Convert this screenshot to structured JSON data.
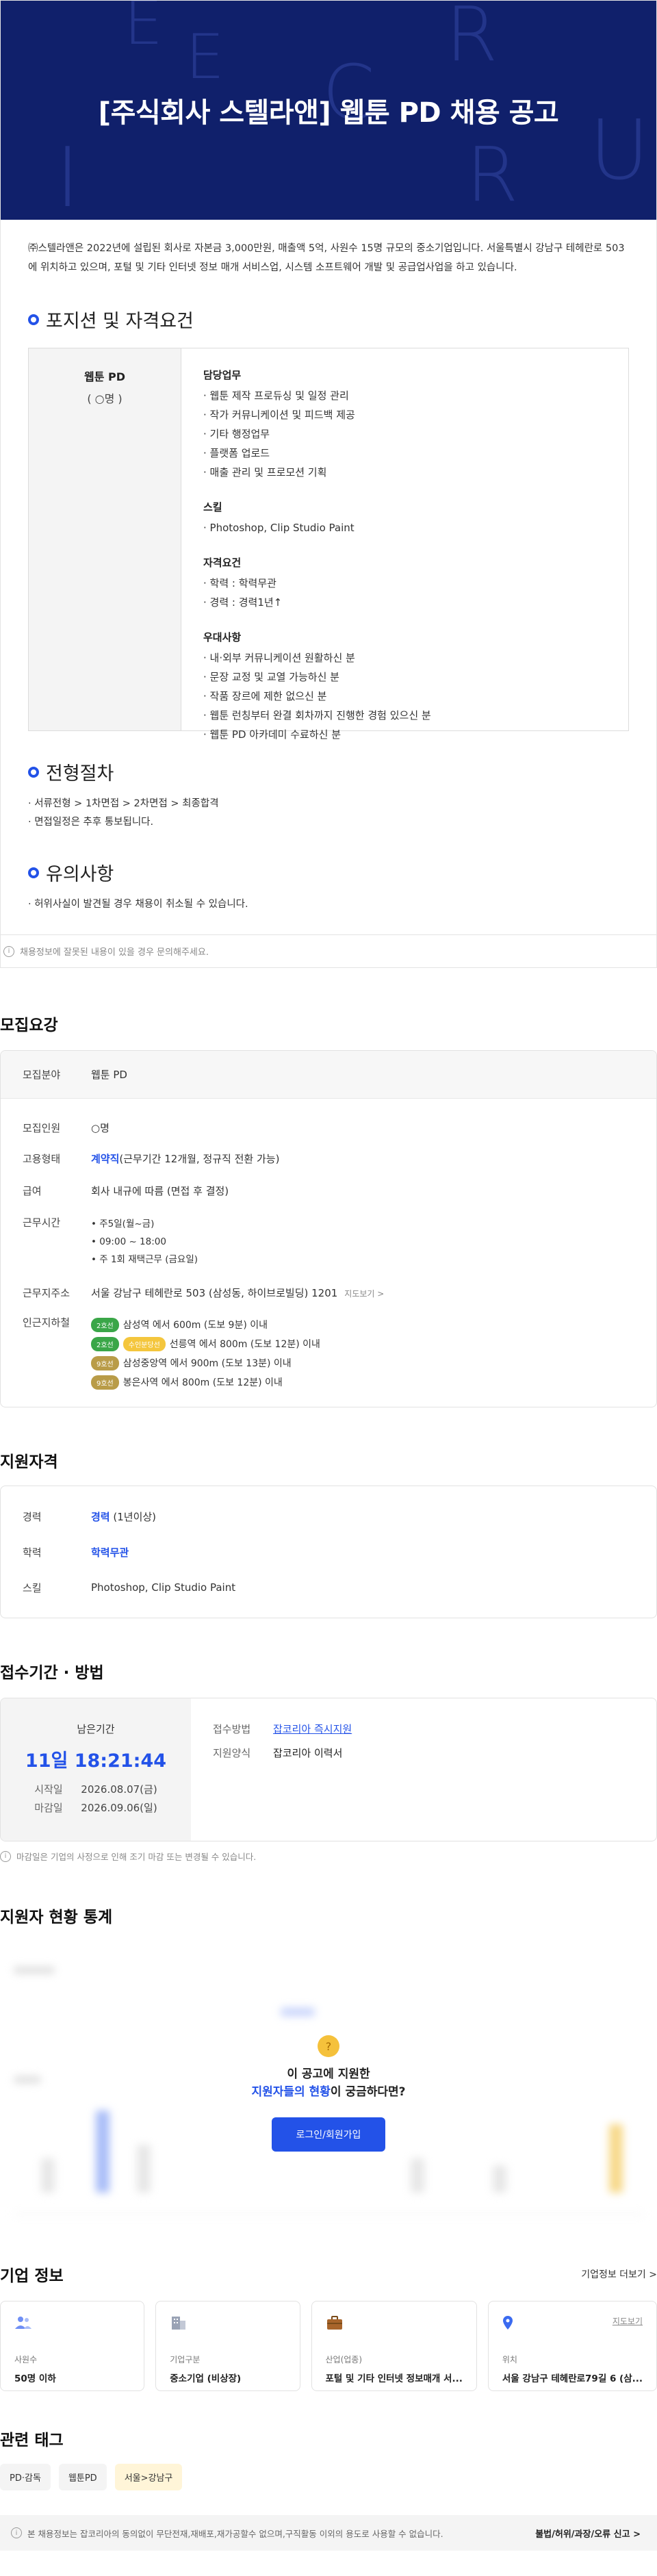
{
  "detail": {
    "hero_title": "[주식회사 스텔라앤] 웹툰 PD 채용 공고",
    "hero_letters": [
      "E",
      "E",
      "R",
      "C",
      "U",
      "I",
      "R"
    ],
    "intro": "㈜스텔라앤은 2022년에 설립된 회사로 자본금 3,000만원, 매출액 5억, 사원수 15명 규모의 중소기업입니다. 서울특별시 강남구 테헤란로 503에 위치하고 있으며, 포털 및 기타 인터넷 정보 매개 서비스업, 시스템 소프트웨어 개발 및 공급업사업을 하고 있습니다.",
    "position_heading": "포지션 및 자격요건",
    "position": {
      "title": "웹툰 PD",
      "count": "( ○명 )",
      "groups": [
        {
          "heading": "담당업무",
          "items": [
            "· 웹툰 제작 프로듀싱 및 일정 관리",
            "· 작가 커뮤니케이션 및 피드백 제공",
            "· 기타 행정업무",
            "· 플랫폼 업로드",
            "· 매출 관리 및 프로모션 기획"
          ]
        },
        {
          "heading": "스킬",
          "items": [
            "· Photoshop, Clip Studio Paint"
          ]
        },
        {
          "heading": "자격요건",
          "items": [
            "· 학력 : 학력무관",
            "· 경력 : 경력1년↑"
          ]
        },
        {
          "heading": "우대사항",
          "items": [
            "· 내·외부 커뮤니케이션 원활하신 분",
            "· 문장 교정 및 교열 가능하신 분",
            "· 작품 장르에 제한 없으신 분",
            "· 웹툰 런칭부터 완결 회차까지 진행한 경험 있으신 분",
            "· 웹툰 PD 아카데미 수료하신 분"
          ]
        }
      ]
    },
    "process_heading": "전형절차",
    "process": [
      "· 서류전형 > 1차면접 > 2차면접 > 최종합격",
      "· 면접일정은 추후 통보됩니다."
    ],
    "caution_heading": "유의사항",
    "caution": [
      "· 허위사실이 발견될 경우 채용이 취소될 수 있습니다."
    ],
    "notice": "채용정보에 잘못된 내용이 있을 경우 문의해주세요."
  },
  "recruit": {
    "title": "모집요강",
    "field_label": "모집분야",
    "field_value": "웹툰 PD",
    "rows": [
      {
        "k": "모집인원",
        "v": "○명"
      }
    ],
    "employment_label": "고용형태",
    "employment_strong": "계약직",
    "employment_rest": "(근무기간 12개월, 정규직 전환 가능)",
    "salary_label": "급여",
    "salary_value": "회사 내규에 따름 (면접 후 결정)",
    "worktime_label": "근무시간",
    "worktime": [
      "• 주5일(월~금)",
      "• 09:00 ~ 18:00",
      "• 주 1회 재택근무 (금요일)"
    ],
    "address_label": "근무지주소",
    "address_value": "서울 강남구 테헤란로 503 (삼성동, 하이브로빌딩) 1201",
    "map_link": "지도보기 >",
    "subway_label": "인근지하철",
    "subway": [
      {
        "badges": [
          {
            "text": "2호선",
            "cls": "b2"
          }
        ],
        "text": "삼성역 에서 600m (도보 9분) 이내"
      },
      {
        "badges": [
          {
            "text": "2호선",
            "cls": "b2"
          },
          {
            "text": "수인분당선",
            "cls": "bsin"
          }
        ],
        "text": "선릉역 에서 800m (도보 12분) 이내"
      },
      {
        "badges": [
          {
            "text": "9호선",
            "cls": "b9"
          }
        ],
        "text": "삼성중앙역 에서 900m (도보 13분) 이내"
      },
      {
        "badges": [
          {
            "text": "9호선",
            "cls": "b9"
          }
        ],
        "text": "봉은사역 에서 800m (도보 12분) 이내"
      }
    ]
  },
  "qualification": {
    "title": "지원자격",
    "career_label": "경력",
    "career_strong": "경력",
    "career_rest": " (1년이상)",
    "edu_label": "학력",
    "edu_value": "학력무관",
    "skill_label": "스킬",
    "skill_value": "Photoshop, Clip Studio Paint"
  },
  "apply": {
    "title": "접수기간 · 방법",
    "remaining_label": "남은기간",
    "countdown": "11일 18:21:44",
    "start_label": "시작일",
    "start_value": "2026.08.07(금)",
    "end_label": "마감일",
    "end_value": "2026.09.06(일)",
    "method_label": "접수방법",
    "method_value": "잡코리아 즉시지원",
    "form_label": "지원양식",
    "form_value": "잡코리아 이력서",
    "notice": "마감일은 기업의 사정으로 인해 조기 마감 또는 변경될 수 있습니다."
  },
  "stats": {
    "title": "지원자 현황 통계",
    "q1": "이 공고에 지원한",
    "q2_strong": "지원자들의 현황",
    "q2_rest": "이 궁금하다면?",
    "login_button": "로그인/회원가입"
  },
  "company": {
    "title": "기업 정보",
    "more": "기업정보 더보기 >",
    "cards": [
      {
        "label": "사원수",
        "value": "50명 이하",
        "icon": "people-icon"
      },
      {
        "label": "기업구분",
        "value": "중소기업 (비상장)",
        "icon": "building-icon"
      },
      {
        "label": "산업(업종)",
        "value": "포털 및 기타 인터넷 정보매개 서...",
        "icon": "briefcase-icon"
      },
      {
        "label": "위치",
        "value": "서울 강남구 테헤란로79길 6 (삼...",
        "icon": "location-pin-icon",
        "link": "지도보기"
      }
    ]
  },
  "tags": {
    "title": "관련 태그",
    "items": [
      {
        "text": "PD·감독",
        "warm": false
      },
      {
        "text": "웹툰PD",
        "warm": false
      },
      {
        "text": "서울>강남구",
        "warm": true
      }
    ]
  },
  "footer": {
    "text": "본 채용정보는 잡코리아의 동의없이 무단전재,재배포,재가공할수 없으며,구직활동 이외의 용도로 사용할 수 없습니다.",
    "report": "불법/허위/과장/오류 신고 >"
  },
  "colors": {
    "hero": "#10206b",
    "accent": "#2352e8"
  }
}
